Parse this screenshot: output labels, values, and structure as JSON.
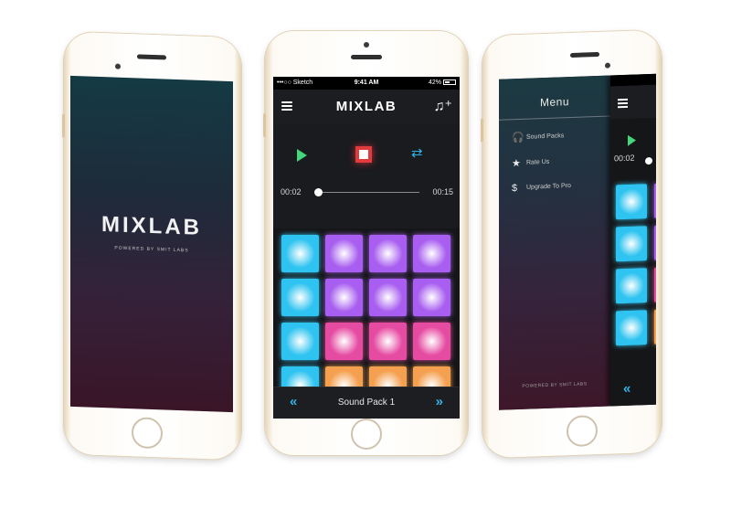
{
  "splash": {
    "logo": "MIXLAB",
    "tagline": "POWERED BY SMIT LABS",
    "bg_top": "#143a44",
    "bg_bottom": "#3a1528"
  },
  "main": {
    "status_bar": {
      "carrier": "•••○○ Sketch",
      "time": "9:41 AM",
      "battery": "42%"
    },
    "nav": {
      "menu_icon": "hamburger-icon",
      "title": "MIXLAB",
      "add_music_icon": "music-plus-icon"
    },
    "transport": {
      "play_icon": "play-icon",
      "stop_icon": "stop-icon",
      "loop_icon": "repeat-icon",
      "elapsed": "00:02",
      "duration": "00:15",
      "progress": 0.03
    },
    "pads": [
      "blue",
      "purple",
      "purple",
      "purple",
      "blue",
      "purple",
      "purple",
      "purple",
      "blue",
      "pink",
      "pink",
      "pink",
      "blue",
      "orange",
      "orange",
      "orange"
    ],
    "pad_colors": {
      "blue": "#2ec3f0",
      "purple": "#a85ef0",
      "pink": "#e64ba2",
      "orange": "#f5a050"
    },
    "sound_pack": "Sound Pack 1",
    "prev_icon": "chevron-double-left-icon",
    "next_icon": "chevron-double-right-icon",
    "accent": "#2fb5e8"
  },
  "menu": {
    "title": "Menu",
    "items": [
      {
        "icon": "headphones-icon",
        "label": "Sound Packs"
      },
      {
        "icon": "star-icon",
        "label": "Rate Us"
      },
      {
        "icon": "dollar-icon",
        "label": "Upgrade To Pro"
      }
    ],
    "powered_by": "POWERED BY SMIT LABS",
    "peek_time": "00:02"
  }
}
